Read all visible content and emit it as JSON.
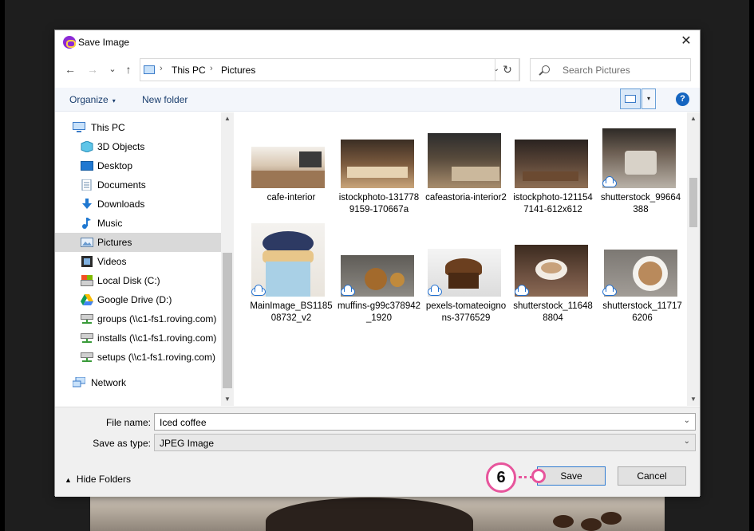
{
  "dialog": {
    "title": "Save Image",
    "close_glyph": "✕"
  },
  "nav": {
    "back_glyph": "←",
    "forward_glyph": "→",
    "recent_glyph": "⌄",
    "up_glyph": "↑",
    "breadcrumb": [
      "This PC",
      "Pictures"
    ],
    "separator_glyph": "›",
    "dropdown_glyph": "⌄",
    "refresh_glyph": "↻",
    "search_placeholder": "Search Pictures"
  },
  "toolbar": {
    "organize": "Organize",
    "organize_arrow": "▾",
    "new_folder": "New folder",
    "view_drop": "▾",
    "help": "?"
  },
  "sidebar": {
    "items": [
      {
        "label": "This PC",
        "icon": "computer-icon"
      },
      {
        "label": "3D Objects",
        "icon": "cube-icon"
      },
      {
        "label": "Desktop",
        "icon": "desktop-icon"
      },
      {
        "label": "Documents",
        "icon": "documents-icon"
      },
      {
        "label": "Downloads",
        "icon": "download-icon"
      },
      {
        "label": "Music",
        "icon": "music-icon"
      },
      {
        "label": "Pictures",
        "icon": "pictures-icon"
      },
      {
        "label": "Videos",
        "icon": "video-icon"
      },
      {
        "label": "Local Disk (C:)",
        "icon": "drive-icon"
      },
      {
        "label": "Google Drive (D:)",
        "icon": "google-drive-icon"
      },
      {
        "label": "groups (\\\\c1-fs1.roving.com)",
        "icon": "network-drive-icon"
      },
      {
        "label": "installs (\\\\c1-fs1.roving.com)",
        "icon": "network-drive-icon"
      },
      {
        "label": "setups (\\\\c1-fs1.roving.com)",
        "icon": "network-drive-icon"
      },
      {
        "label": "Network",
        "icon": "network-icon"
      }
    ],
    "scroll_up": "▲",
    "scroll_down": "▼"
  },
  "files": [
    {
      "name": "cafe-interior",
      "cloud": false
    },
    {
      "name": "istockphoto-1317789159-170667a",
      "cloud": false
    },
    {
      "name": "cafeastoria-interior2",
      "cloud": false
    },
    {
      "name": "istockphoto-1211547141-612x612",
      "cloud": false
    },
    {
      "name": "shutterstock_99664388",
      "cloud": true
    },
    {
      "name": "MainImage_BS118508732_v2",
      "cloud": true
    },
    {
      "name": "muffins-g99c378942_1920",
      "cloud": true
    },
    {
      "name": "pexels-tomateoignons-3776529",
      "cloud": true
    },
    {
      "name": "shutterstock_116488804",
      "cloud": true
    },
    {
      "name": "shutterstock_117176206",
      "cloud": true
    }
  ],
  "form": {
    "file_name_label": "File name:",
    "file_name_value": "Iced coffee",
    "save_type_label": "Save as type:",
    "save_type_value": "JPEG Image",
    "chevron": "⌄",
    "hide_folders_caret": "▲",
    "hide_folders": "Hide Folders",
    "save": "Save",
    "cancel": "Cancel"
  },
  "annotation": {
    "step": "6",
    "color": "#e7559c"
  }
}
